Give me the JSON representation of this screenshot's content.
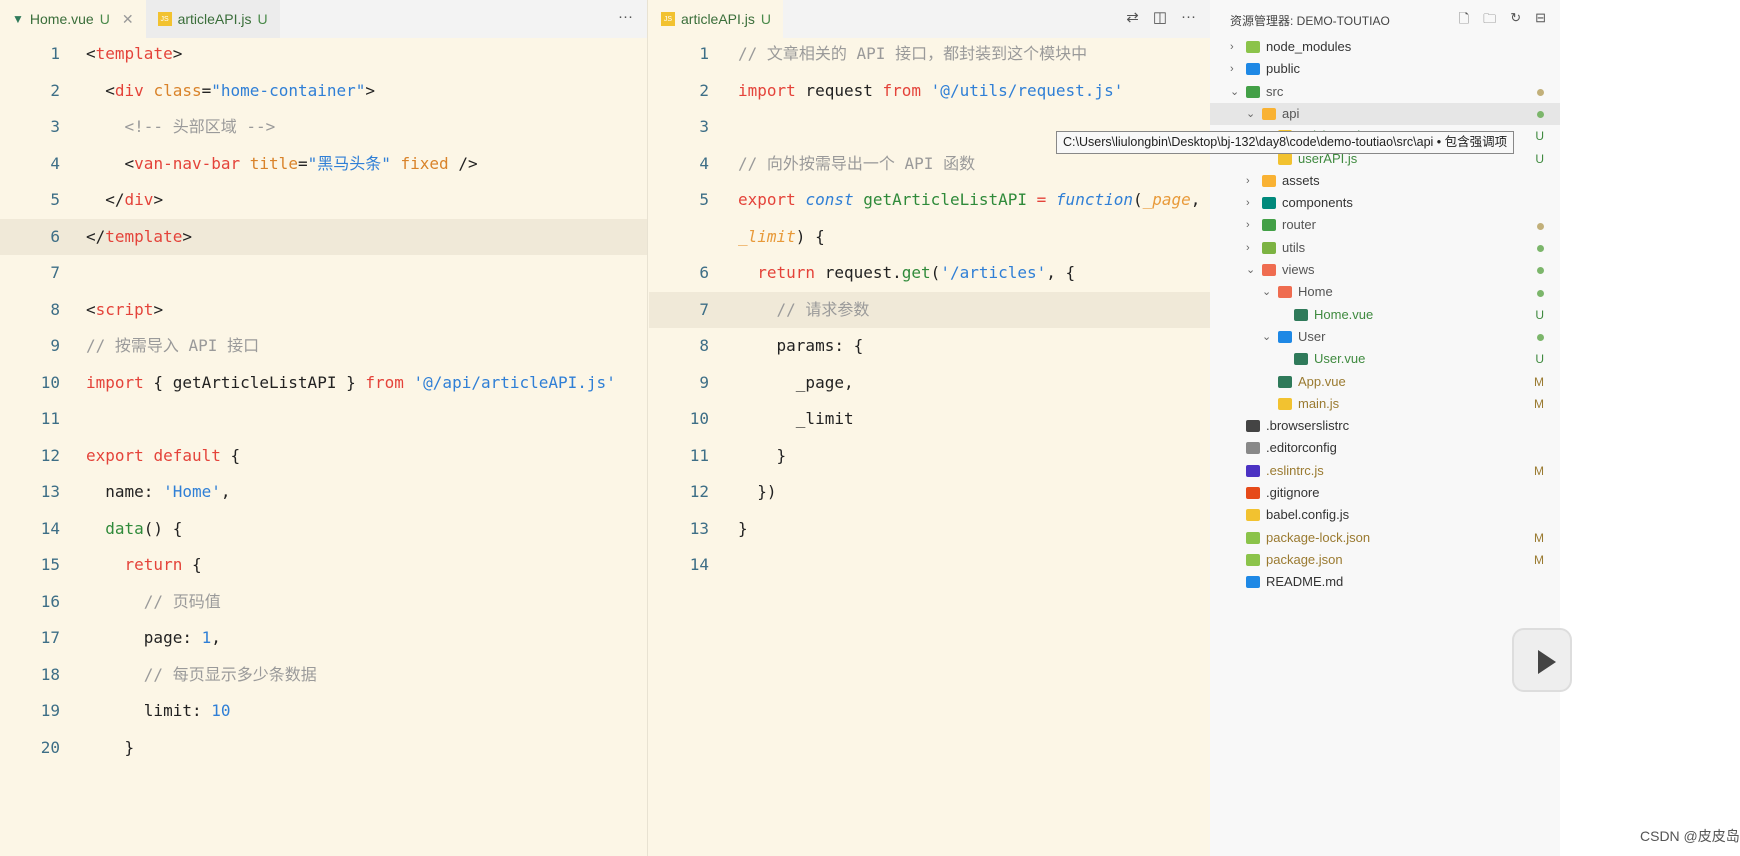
{
  "left_editor": {
    "tabs": [
      {
        "label": "Home.vue",
        "status": "U",
        "icon": "vue-icon",
        "active": true
      },
      {
        "label": "articleAPI.js",
        "status": "U",
        "icon": "js-icon",
        "active": false
      }
    ],
    "more": "···",
    "highlight_line": 6,
    "lines": [
      [
        [
          "<",
          "p"
        ],
        [
          "template",
          "tag"
        ],
        [
          ">",
          "p"
        ]
      ],
      [
        [
          "  <",
          "p"
        ],
        [
          "div",
          "tag"
        ],
        [
          " ",
          "p"
        ],
        [
          "class",
          "attr"
        ],
        [
          "=",
          "p"
        ],
        [
          "\"home-container\"",
          "str"
        ],
        [
          ">",
          "p"
        ]
      ],
      [
        [
          "    <!-- 头部区域 -->",
          "cm"
        ]
      ],
      [
        [
          "    <",
          "p"
        ],
        [
          "van-nav-bar",
          "tag"
        ],
        [
          " ",
          "p"
        ],
        [
          "title",
          "attr"
        ],
        [
          "=",
          "p"
        ],
        [
          "\"黑马头条\"",
          "str"
        ],
        [
          " ",
          "p"
        ],
        [
          "fixed",
          "attr"
        ],
        [
          " />",
          "p"
        ]
      ],
      [
        [
          "  </",
          "p"
        ],
        [
          "div",
          "tag"
        ],
        [
          ">",
          "p"
        ]
      ],
      [
        [
          "</",
          "p"
        ],
        [
          "template",
          "tag"
        ],
        [
          ">",
          "p"
        ]
      ],
      [],
      [
        [
          "<",
          "p"
        ],
        [
          "script",
          "tag"
        ],
        [
          ">",
          "p"
        ]
      ],
      [
        [
          "// 按需导入 API 接口",
          "cm"
        ]
      ],
      [
        [
          "import",
          "kw"
        ],
        [
          " { getArticleListAPI } ",
          "p"
        ],
        [
          "from",
          "kw"
        ],
        [
          " ",
          "p"
        ],
        [
          "'@/api/articleAPI.js'",
          "str"
        ]
      ],
      [],
      [
        [
          "export",
          "kw"
        ],
        [
          " ",
          "p"
        ],
        [
          "default",
          "kw"
        ],
        [
          " {",
          "p"
        ]
      ],
      [
        [
          "  name: ",
          "p"
        ],
        [
          "'Home'",
          "str"
        ],
        [
          ",",
          "p"
        ]
      ],
      [
        [
          "  ",
          "p"
        ],
        [
          "data",
          "fn"
        ],
        [
          "() {",
          "p"
        ]
      ],
      [
        [
          "    ",
          "p"
        ],
        [
          "return",
          "kw"
        ],
        [
          " {",
          "p"
        ]
      ],
      [
        [
          "      // 页码值",
          "cm"
        ]
      ],
      [
        [
          "      page: ",
          "p"
        ],
        [
          "1",
          "num"
        ],
        [
          ",",
          "p"
        ]
      ],
      [
        [
          "      // 每页显示多少条数据",
          "cm"
        ]
      ],
      [
        [
          "      limit: ",
          "p"
        ],
        [
          "10",
          "num"
        ]
      ],
      [
        [
          "    }",
          "p"
        ]
      ]
    ]
  },
  "right_editor": {
    "tabs": [
      {
        "label": "articleAPI.js",
        "status": "U",
        "icon": "js-icon",
        "active": true
      }
    ],
    "actions": [
      "⇄",
      "◫",
      "···"
    ],
    "highlight_line": 7,
    "lines": [
      {
        "n": "1",
        "t": [
          [
            "// 文章相关的 API 接口，都封装到这个模块中",
            "cm"
          ]
        ]
      },
      {
        "n": "2",
        "t": [
          [
            "import",
            "kw"
          ],
          [
            " request ",
            "p"
          ],
          [
            "from",
            "kw"
          ],
          [
            " ",
            "p"
          ],
          [
            "'@/utils/request.js'",
            "str"
          ]
        ]
      },
      {
        "n": "3",
        "t": []
      },
      {
        "n": "4",
        "t": [
          [
            "// 向外按需导出一个 API 函数",
            "cm"
          ]
        ]
      },
      {
        "n": "5",
        "t": [
          [
            "export",
            "kw"
          ],
          [
            " ",
            "p"
          ],
          [
            "const",
            "it"
          ],
          [
            " ",
            "p"
          ],
          [
            "getArticleListAPI",
            "fn"
          ],
          [
            " = ",
            "kw"
          ],
          [
            "function",
            "it"
          ],
          [
            "(",
            "p"
          ],
          [
            "_page",
            "par"
          ],
          [
            ",",
            "p"
          ]
        ]
      },
      {
        "n": "",
        "t": [
          [
            "_limit",
            "par"
          ],
          [
            ") {",
            "p"
          ]
        ]
      },
      {
        "n": "6",
        "t": [
          [
            "  ",
            "p"
          ],
          [
            "return",
            "kw"
          ],
          [
            " request.",
            "p"
          ],
          [
            "get",
            "fn"
          ],
          [
            "(",
            "p"
          ],
          [
            "'/articles'",
            "str"
          ],
          [
            ", {",
            "p"
          ]
        ]
      },
      {
        "n": "7",
        "t": [
          [
            "    // 请求参数",
            "cm"
          ]
        ]
      },
      {
        "n": "8",
        "t": [
          [
            "    params: {",
            "p"
          ]
        ]
      },
      {
        "n": "9",
        "t": [
          [
            "      _page,",
            "p"
          ]
        ]
      },
      {
        "n": "10",
        "t": [
          [
            "      _limit",
            "p"
          ]
        ]
      },
      {
        "n": "11",
        "t": [
          [
            "    }",
            "p"
          ]
        ]
      },
      {
        "n": "12",
        "t": [
          [
            "  })",
            "p"
          ]
        ]
      },
      {
        "n": "13",
        "t": [
          [
            "}",
            "p"
          ]
        ]
      },
      {
        "n": "14",
        "t": []
      }
    ]
  },
  "explorer": {
    "title": "资源管理器: DEMO-TOUTIAO",
    "actions": [
      "new-file-icon",
      "new-folder-icon",
      "refresh-icon",
      "collapse-icon"
    ],
    "items": [
      {
        "name": "node_modules",
        "depth": 0,
        "chev": "›",
        "color": "#8bc34a",
        "status": ""
      },
      {
        "name": "public",
        "depth": 0,
        "chev": "›",
        "color": "#1e88e5",
        "status": ""
      },
      {
        "name": "src",
        "depth": 0,
        "chev": "⌄",
        "color": "#43a047",
        "status": "dot-olive"
      },
      {
        "name": "api",
        "depth": 1,
        "chev": "⌄",
        "color": "#f9b233",
        "status": "dot-green",
        "selected": true
      },
      {
        "name": "articleAPI.js",
        "depth": 2,
        "chev": "",
        "color": "#f2c230",
        "status": "U"
      },
      {
        "name": "userAPI.js",
        "depth": 2,
        "chev": "",
        "color": "#f2c230",
        "status": "U"
      },
      {
        "name": "assets",
        "depth": 1,
        "chev": "›",
        "color": "#f9b233",
        "status": ""
      },
      {
        "name": "components",
        "depth": 1,
        "chev": "›",
        "color": "#00897b",
        "status": ""
      },
      {
        "name": "router",
        "depth": 1,
        "chev": "›",
        "color": "#43a047",
        "status": "dot-olive"
      },
      {
        "name": "utils",
        "depth": 1,
        "chev": "›",
        "color": "#7cb342",
        "status": "dot-green"
      },
      {
        "name": "views",
        "depth": 1,
        "chev": "⌄",
        "color": "#ef6c50",
        "status": "dot-green"
      },
      {
        "name": "Home",
        "depth": 2,
        "chev": "⌄",
        "color": "#ef6c50",
        "status": "dot-green"
      },
      {
        "name": "Home.vue",
        "depth": 3,
        "chev": "",
        "color": "#2f7a5a",
        "status": "U"
      },
      {
        "name": "User",
        "depth": 2,
        "chev": "⌄",
        "color": "#1e88e5",
        "status": "dot-green"
      },
      {
        "name": "User.vue",
        "depth": 3,
        "chev": "",
        "color": "#2f7a5a",
        "status": "U"
      },
      {
        "name": "App.vue",
        "depth": 2,
        "chev": "",
        "color": "#2f7a5a",
        "status": "M"
      },
      {
        "name": "main.js",
        "depth": 2,
        "chev": "",
        "color": "#f2c230",
        "status": "M"
      },
      {
        "name": ".browserslistrc",
        "depth": 0,
        "chev": "",
        "color": "#444",
        "status": ""
      },
      {
        "name": ".editorconfig",
        "depth": 0,
        "chev": "",
        "color": "#888",
        "status": ""
      },
      {
        "name": ".eslintrc.js",
        "depth": 0,
        "chev": "",
        "color": "#4b32c3",
        "status": "M"
      },
      {
        "name": ".gitignore",
        "depth": 0,
        "chev": "",
        "color": "#e64a19",
        "status": ""
      },
      {
        "name": "babel.config.js",
        "depth": 0,
        "chev": "",
        "color": "#f2c230",
        "status": ""
      },
      {
        "name": "package-lock.json",
        "depth": 0,
        "chev": "",
        "color": "#8bc34a",
        "status": "M"
      },
      {
        "name": "package.json",
        "depth": 0,
        "chev": "",
        "color": "#8bc34a",
        "status": "M"
      },
      {
        "name": "README.md",
        "depth": 0,
        "chev": "",
        "color": "#1e88e5",
        "status": ""
      }
    ],
    "tooltip": "C:\\Users\\liulongbin\\Desktop\\bj-132\\day8\\code\\demo-toutiao\\src\\api • 包含强调项"
  },
  "watermark": "CSDN @皮皮岛"
}
